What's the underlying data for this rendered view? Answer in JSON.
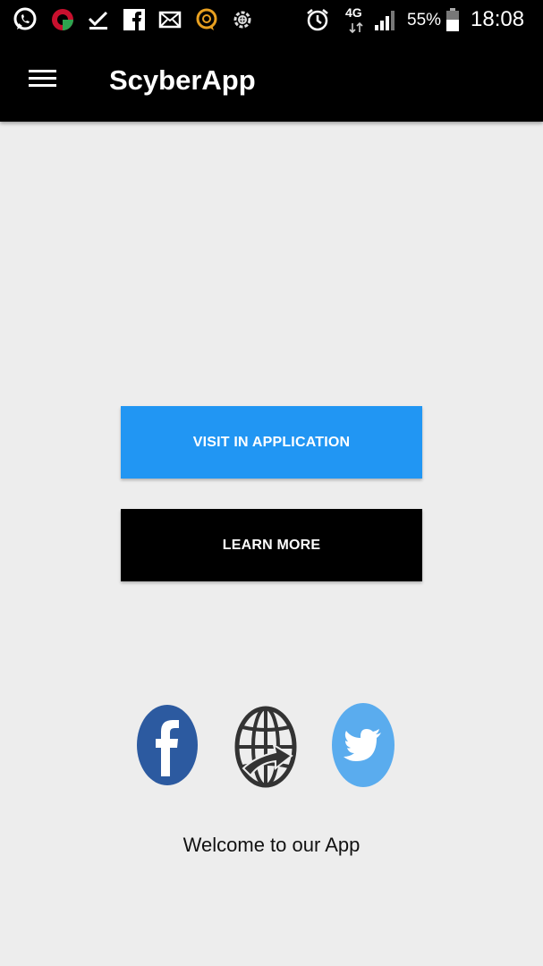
{
  "status_bar": {
    "network": "4G",
    "battery": "55%",
    "time": "18:08",
    "icons": [
      "whatsapp-icon",
      "opera-icon",
      "download-done-icon",
      "facebook-notify-icon",
      "mail-icon",
      "chat-icon",
      "settings-icon",
      "alarm-icon",
      "network-icon",
      "signal-icon",
      "battery-icon"
    ]
  },
  "app_bar": {
    "title": "ScyberApp",
    "menu_icon": "hamburger-menu-icon"
  },
  "main": {
    "primary_button": "VISIT IN APPLICATION",
    "secondary_button": "LEARN MORE",
    "social_icons": [
      "facebook-icon",
      "website-globe-icon",
      "twitter-icon"
    ],
    "welcome_text": "Welcome to our App"
  },
  "colors": {
    "accent": "#2196f3",
    "background": "#ededed",
    "app_bar": "#000000",
    "facebook": "#2c5aa0",
    "twitter": "#5aacee",
    "globe": "#333333"
  }
}
